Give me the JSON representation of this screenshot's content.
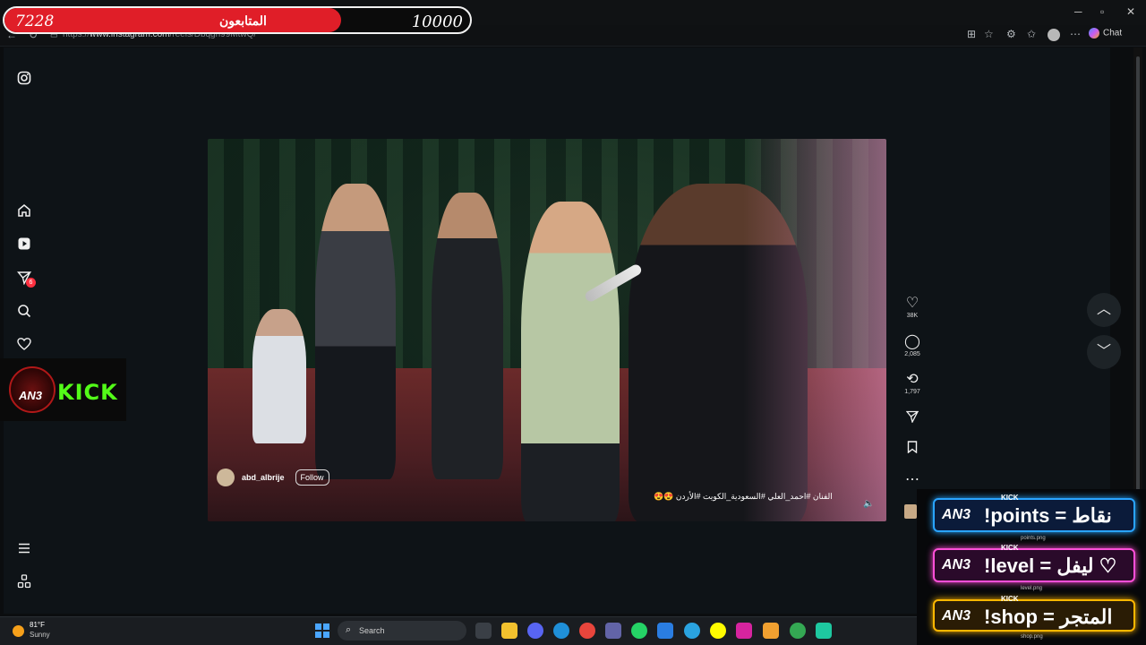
{
  "browser": {
    "url_prefix": "https://",
    "url_host": "www.instagram.com",
    "url_path": "/reels/Dbqgn99MtwQ/",
    "chat_label": "Chat"
  },
  "overlay": {
    "follower_count": "7228",
    "follower_label": "المتابعون",
    "follower_goal": "10000",
    "follower_progress": 0.7228
  },
  "sidebar": {
    "notifications_badge": "6"
  },
  "reel": {
    "username": "abd_albrije",
    "follow_label": "Follow",
    "caption": "الفنان #احمد_العلي #السعودية_الكويت #الأردن 😍😍"
  },
  "actions": {
    "likes": "38K",
    "comments": "2,085",
    "reposts": "1,797"
  },
  "kick": {
    "logo_text": "AN3",
    "word": "KICK"
  },
  "commands": {
    "kick_tag": "KICK",
    "an3": "AN3",
    "points": "!points = نقاط",
    "points_file": "points.png",
    "level": "!level = ليفل ♡",
    "level_file": "level.png",
    "shop": "!shop = المتجر",
    "shop_file": "shop.png"
  },
  "taskbar": {
    "temp": "81°F",
    "condition": "Sunny",
    "search_label": "Search"
  },
  "colors": {
    "accent_red": "#e01e28",
    "kick_green": "#53fc18",
    "points_blue": "#29a4ff",
    "level_pink": "#ff4fd8",
    "shop_gold": "#ffb700"
  }
}
